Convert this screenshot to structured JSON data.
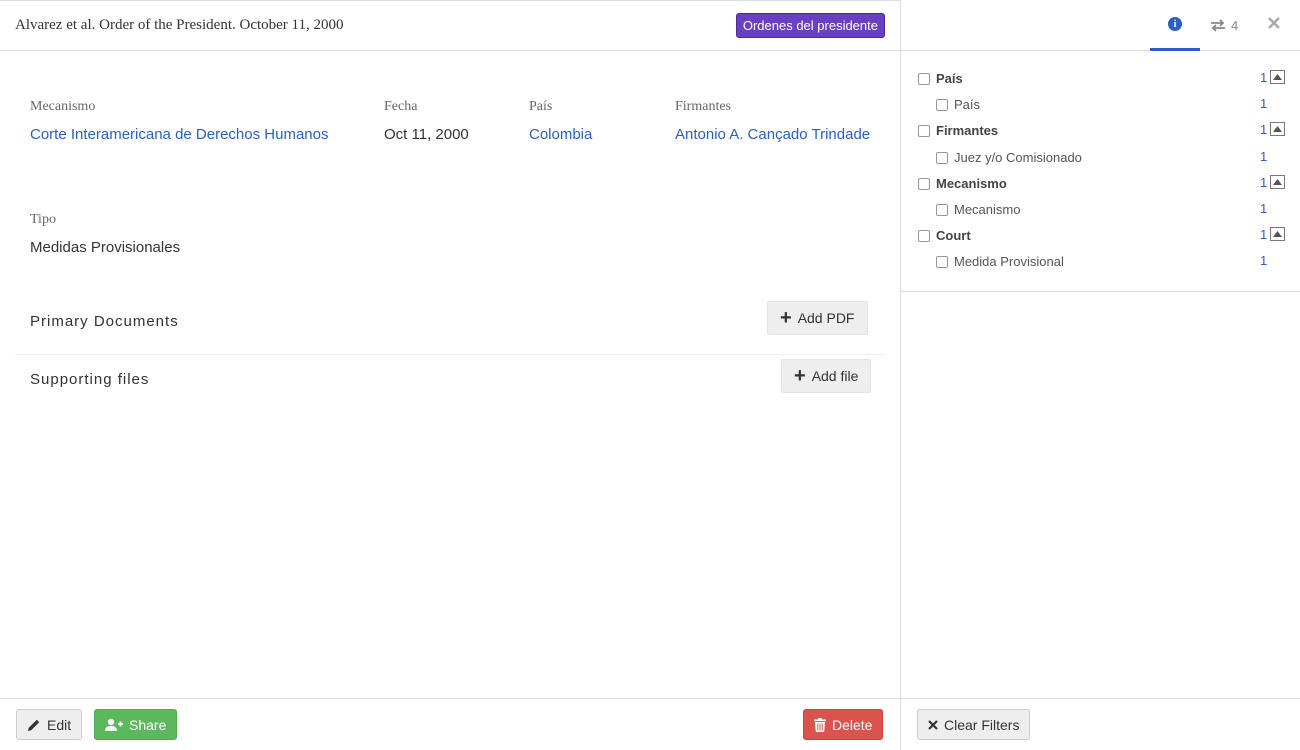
{
  "document": {
    "title": "Alvarez et al. Order of the President. October 11, 2000",
    "type_badge": "Ordenes del presidente",
    "badge_color": "#6b3fc2"
  },
  "metadata": {
    "mecanismo": {
      "label": "Mecanismo",
      "value": "Corte Interamericana de Derechos Humanos"
    },
    "fecha": {
      "label": "Fecha",
      "value": "Oct 11, 2000"
    },
    "pais": {
      "label": "País",
      "value": "Colombia"
    },
    "firmantes": {
      "label": "Firmantes",
      "value": "Antonio A. Cançado Trindade"
    },
    "tipo": {
      "label": "Tipo",
      "value": "Medidas Provisionales"
    }
  },
  "sections": {
    "primary_documents": {
      "title": "Primary Documents",
      "button": "Add PDF"
    },
    "supporting_files": {
      "title": "Supporting files",
      "button": "Add file"
    }
  },
  "footer": {
    "edit": "Edit",
    "share": "Share",
    "delete": "Delete"
  },
  "side_panel": {
    "tabs": {
      "info_icon": "info-circle-icon",
      "relations_count": "4"
    },
    "filters": [
      {
        "label": "País",
        "count": "1",
        "child": {
          "label": "País",
          "count": "1"
        }
      },
      {
        "label": "Firmantes",
        "count": "1",
        "child": {
          "label": "Juez y/o Comisionado",
          "count": "1"
        }
      },
      {
        "label": "Mecanismo",
        "count": "1",
        "child": {
          "label": "Mecanismo",
          "count": "1"
        }
      },
      {
        "label": "Court",
        "count": "1",
        "child": {
          "label": "Medida Provisional",
          "count": "1"
        }
      }
    ],
    "clear_filters": "Clear Filters"
  },
  "colors": {
    "link": "#2b5fc4",
    "share": "#5cb85c",
    "delete": "#d9534f"
  }
}
